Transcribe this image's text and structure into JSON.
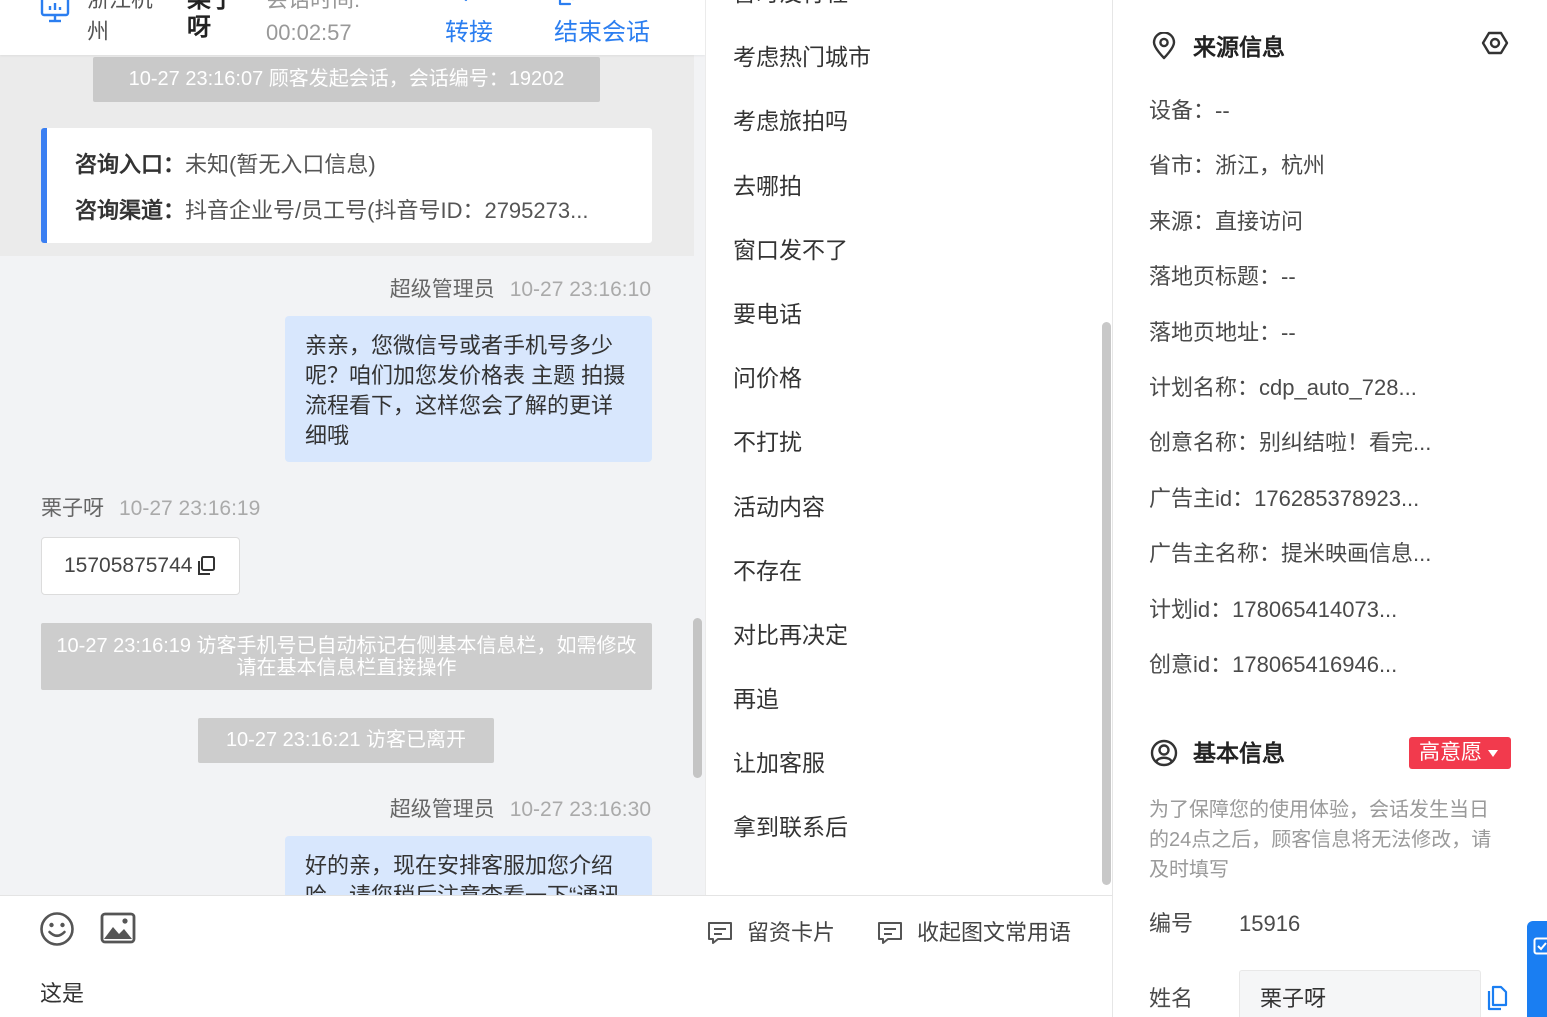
{
  "header": {
    "location": "浙江杭州",
    "visitor_name": "栗子呀",
    "session_time_label": "会话时间:",
    "session_time": "00:02:57",
    "transfer_label": "转接",
    "end_session_label": "结束会话",
    "icons": {
      "visitor_device": "monitor-icon",
      "transfer": "transfer-icon",
      "end_session": "end-session-icon"
    }
  },
  "chat": {
    "system_start": "10-27 23:16:07 顾客发起会话，会话编号：19202",
    "entry_card": {
      "entry_label": "咨询入口：",
      "entry_value": "未知(暂无入口信息)",
      "channel_label": "咨询渠道：",
      "channel_value": "抖音企业号/员工号(抖音号ID：2795273..."
    },
    "messages": [
      {
        "sender": "超级管理员",
        "time": "10-27 23:16:10",
        "text": "亲亲，您微信号或者手机号多少呢？咱们加您发价格表 主题 拍摄流程看下，这样您会了解的更详细哦"
      },
      {
        "sender": "栗子呀",
        "time": "10-27 23:16:19",
        "text": "15705875744"
      },
      {
        "sender": "超级管理员",
        "time": "10-27 23:16:30",
        "text": "好的亲，现在安排客服加您介绍哈，请您稍后注意查看一下“通讯"
      }
    ],
    "system_phone_tagged": "10-27 23:16:19 访客手机号已自动标记右侧基本信息栏，如需修改请在基本信息栏直接操作",
    "system_visitor_left": "10-27 23:16:21 访客已离开",
    "icons": {
      "copy": "copy-icon"
    }
  },
  "composer": {
    "lead_card_label": "留资卡片",
    "collapse_phrases_label": "收起图文常用语",
    "input_value": "这是",
    "icons": {
      "emoji": "smile-icon",
      "image": "image-icon",
      "lead_card": "message-card-icon",
      "collapse_phrases": "message-card-icon"
    }
  },
  "quick_phrases": [
    "暂时没行程",
    "考虑热门城市",
    "考虑旅拍吗",
    "去哪拍",
    "窗口发不了",
    "要电话",
    "问价格",
    "不打扰",
    "活动内容",
    "不存在",
    "对比再决定",
    "再追",
    "让加客服",
    "拿到联系后"
  ],
  "source_info": {
    "title": "来源信息",
    "rows": [
      {
        "label": "设备：",
        "value": "--"
      },
      {
        "label": "省市：",
        "value": "浙江，杭州"
      },
      {
        "label": "来源：",
        "value": "直接访问"
      },
      {
        "label": "落地页标题：",
        "value": "--"
      },
      {
        "label": "落地页地址：",
        "value": "--"
      },
      {
        "label": "计划名称：",
        "value": "cdp_auto_728..."
      },
      {
        "label": "创意名称：",
        "value": "别纠结啦！看完..."
      },
      {
        "label": "广告主id：",
        "value": "176285378923..."
      },
      {
        "label": "广告主名称：",
        "value": "提米映画信息..."
      },
      {
        "label": "计划id：",
        "value": "178065414073..."
      },
      {
        "label": "创意id：",
        "value": "178065416946..."
      }
    ],
    "icons": {
      "section": "location-pin-icon",
      "settings": "hexagon-settings-icon"
    }
  },
  "basic_info": {
    "title": "基本信息",
    "intent_badge": "高意愿",
    "notice": "为了保障您的使用体验，会话发生当日的24点之后，顾客信息将无法修改，请及时填写",
    "id_label": "编号",
    "id_value": "15916",
    "name_label": "姓名",
    "name_value": "栗子呀",
    "icons": {
      "section": "user-circle-icon",
      "copy": "copy-icon",
      "float_tab": "checklist-icon"
    }
  },
  "colors": {
    "accent": "#2b7ef0",
    "agent_bubble": "#d8e7fd",
    "system_notice": "#c9c9c9",
    "entry_card_border": "#3a7ff2",
    "intent_badge": "#f23a4d",
    "chat_background": "#f2f3f5"
  }
}
